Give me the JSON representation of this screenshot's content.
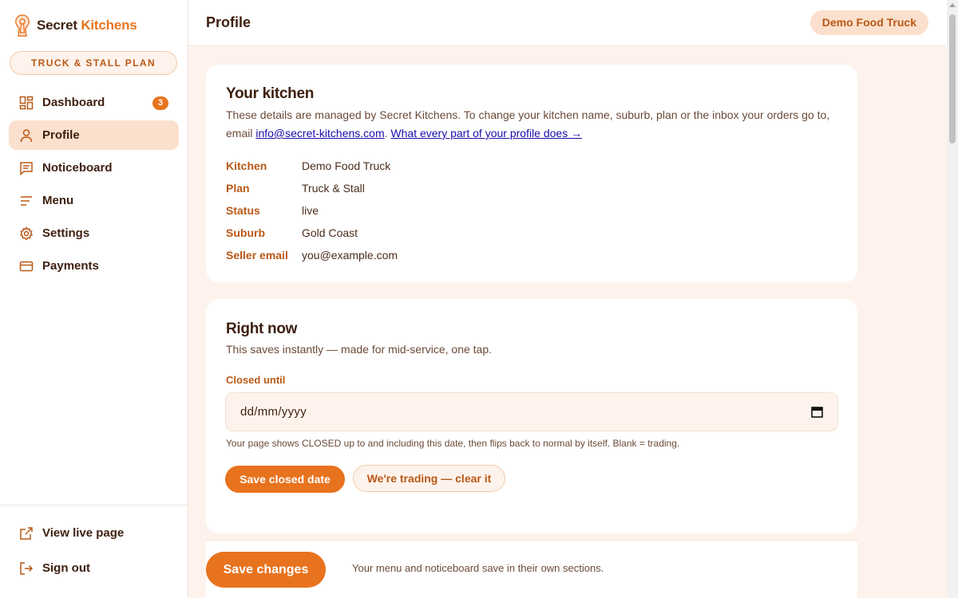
{
  "brand": {
    "name_part1": "Secret",
    "name_part2": "Kitchens"
  },
  "plan_pill": "TRUCK & STALL PLAN",
  "nav": {
    "items": [
      {
        "label": "Dashboard",
        "icon": "dashboard-icon",
        "badge": "3"
      },
      {
        "label": "Profile",
        "icon": "user-icon",
        "active": true
      },
      {
        "label": "Noticeboard",
        "icon": "message-icon"
      },
      {
        "label": "Menu",
        "icon": "menu-lines-icon"
      },
      {
        "label": "Settings",
        "icon": "gear-icon"
      },
      {
        "label": "Payments",
        "icon": "card-icon"
      }
    ],
    "bottom": [
      {
        "label": "View live page",
        "icon": "external-link-icon"
      },
      {
        "label": "Sign out",
        "icon": "sign-out-icon"
      }
    ]
  },
  "header": {
    "title": "Profile",
    "kitchen": "Demo Food Truck"
  },
  "your_kitchen": {
    "title": "Your kitchen",
    "description": "These details are managed by Secret Kitchens. To change your kitchen name, suburb, plan or the inbox your orders go to, email ",
    "email_link": "info@secret-kitchens.com",
    "separator": ". ",
    "help_link": "What every part of your profile does →",
    "fields": [
      {
        "label": "Kitchen",
        "value": "Demo Food Truck"
      },
      {
        "label": "Plan",
        "value": "Truck & Stall"
      },
      {
        "label": "Status",
        "value": "live"
      },
      {
        "label": "Suburb",
        "value": "Gold Coast"
      },
      {
        "label": "Seller email",
        "value": "you@example.com"
      }
    ]
  },
  "right_now": {
    "title": "Right now",
    "description": "This saves instantly — made for mid-service, one tap.",
    "closed_label": "Closed until",
    "date_placeholder": "dd/mm/yyyy",
    "hint": "Your page shows CLOSED up to and including this date, then flips back to normal by itself. Blank = trading.",
    "save_button": "Save closed date",
    "clear_button": "We're trading — clear it"
  },
  "savebar": {
    "button": "Save changes",
    "note": "Your menu and noticeboard save in their own sections."
  },
  "colors": {
    "accent": "#e8731e",
    "accent_dark": "#b95816",
    "background": "#fdf3ec",
    "active_bg": "#fbe0cd"
  }
}
